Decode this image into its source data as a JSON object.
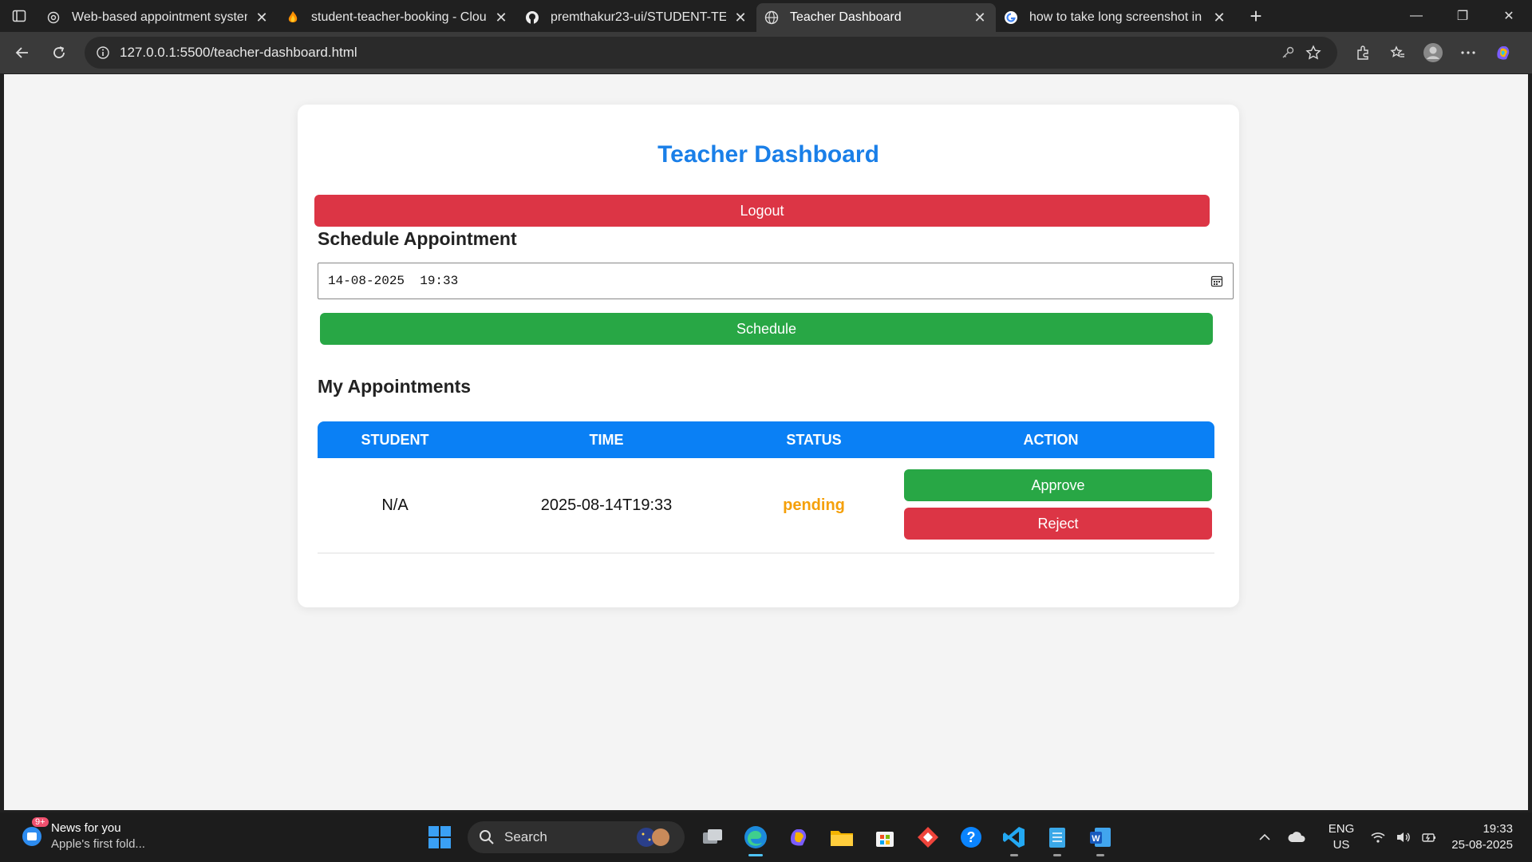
{
  "browser": {
    "tabs": [
      {
        "title": "Web-based appointment system",
        "favicon": "chatgpt-icon"
      },
      {
        "title": "student-teacher-booking - Cloud",
        "favicon": "firebase-icon"
      },
      {
        "title": "premthakur23-ui/STUDENT-TEAC",
        "favicon": "github-icon"
      },
      {
        "title": "Teacher Dashboard",
        "favicon": "globe-icon",
        "active": true
      },
      {
        "title": "how to take long screenshot in la",
        "favicon": "google-icon"
      }
    ],
    "url": "127.0.0.1:5500/teacher-dashboard.html"
  },
  "page": {
    "title": "Teacher Dashboard",
    "logout_label": "Logout",
    "schedule_heading": "Schedule Appointment",
    "datetime_value": "14-08-2025  19:33",
    "schedule_label": "Schedule",
    "appointments_heading": "My Appointments",
    "table": {
      "headers": [
        "STUDENT",
        "TIME",
        "STATUS",
        "ACTION"
      ],
      "rows": [
        {
          "student": "N/A",
          "time": "2025-08-14T19:33",
          "status": "pending",
          "approve_label": "Approve",
          "reject_label": "Reject"
        }
      ]
    }
  },
  "colors": {
    "title_blue": "#1a7fe8",
    "header_blue": "#0a80f5",
    "danger_red": "#dc3545",
    "success_green": "#28a745",
    "pending_orange": "#f5a00a"
  },
  "taskbar": {
    "news_title": "News for you",
    "news_subtitle": "Apple's first fold...",
    "news_badge": "9+",
    "search_label": "Search",
    "lang_top": "ENG",
    "lang_bottom": "US",
    "time": "19:33",
    "date": "25-08-2025"
  }
}
